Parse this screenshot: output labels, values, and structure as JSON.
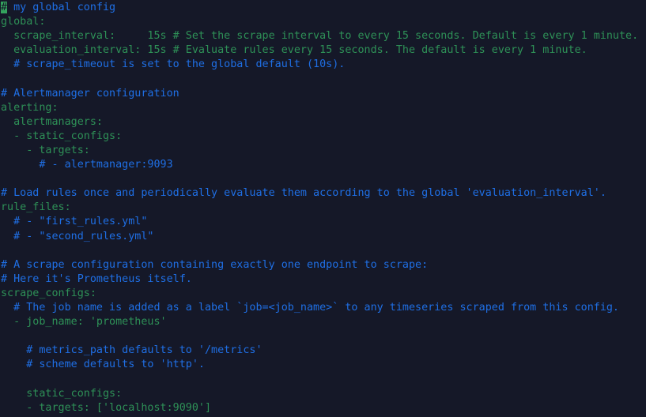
{
  "editor": {
    "background_color": "#151828",
    "comment_color": "#1f6fe5",
    "key_color": "#2e9157",
    "cursor_background_color": "#34a35e",
    "cursor_foreground_color": "#151828",
    "cursor_char": "#",
    "font_size_px": 13.4,
    "line_height_px": 18.1
  },
  "lines": [
    {
      "id": "line-1",
      "segments": [
        {
          "text": "#",
          "kind": "cursor"
        },
        {
          "text": " my global config",
          "kind": "comment"
        }
      ]
    },
    {
      "id": "line-2",
      "segments": [
        {
          "text": "global:",
          "kind": "key"
        }
      ]
    },
    {
      "id": "line-3",
      "segments": [
        {
          "text": "  scrape_interval:     15s # Set the scrape interval to every 15 seconds. Default is every 1 minute.",
          "kind": "key"
        }
      ]
    },
    {
      "id": "line-4",
      "segments": [
        {
          "text": "  evaluation_interval: 15s # Evaluate rules every 15 seconds. The default is every 1 minute.",
          "kind": "key"
        }
      ]
    },
    {
      "id": "line-5",
      "segments": [
        {
          "text": "  # scrape_timeout is set to the global default (10s).",
          "kind": "comment"
        }
      ]
    },
    {
      "id": "line-6",
      "segments": [
        {
          "text": "",
          "kind": "plain"
        }
      ]
    },
    {
      "id": "line-7",
      "segments": [
        {
          "text": "# Alertmanager configuration",
          "kind": "comment"
        }
      ]
    },
    {
      "id": "line-8",
      "segments": [
        {
          "text": "alerting:",
          "kind": "key"
        }
      ]
    },
    {
      "id": "line-9",
      "segments": [
        {
          "text": "  alertmanagers:",
          "kind": "key"
        }
      ]
    },
    {
      "id": "line-10",
      "segments": [
        {
          "text": "  - static_configs:",
          "kind": "key"
        }
      ]
    },
    {
      "id": "line-11",
      "segments": [
        {
          "text": "    - targets:",
          "kind": "key"
        }
      ]
    },
    {
      "id": "line-12",
      "segments": [
        {
          "text": "      # - alertmanager:9093",
          "kind": "comment"
        }
      ]
    },
    {
      "id": "line-13",
      "segments": [
        {
          "text": "",
          "kind": "plain"
        }
      ]
    },
    {
      "id": "line-14",
      "segments": [
        {
          "text": "# Load rules once and periodically evaluate them according to the global 'evaluation_interval'.",
          "kind": "comment"
        }
      ]
    },
    {
      "id": "line-15",
      "segments": [
        {
          "text": "rule_files:",
          "kind": "key"
        }
      ]
    },
    {
      "id": "line-16",
      "segments": [
        {
          "text": "  # - \"first_rules.yml\"",
          "kind": "comment"
        }
      ]
    },
    {
      "id": "line-17",
      "segments": [
        {
          "text": "  # - \"second_rules.yml\"",
          "kind": "comment"
        }
      ]
    },
    {
      "id": "line-18",
      "segments": [
        {
          "text": "",
          "kind": "plain"
        }
      ]
    },
    {
      "id": "line-19",
      "segments": [
        {
          "text": "# A scrape configuration containing exactly one endpoint to scrape:",
          "kind": "comment"
        }
      ]
    },
    {
      "id": "line-20",
      "segments": [
        {
          "text": "# Here it's Prometheus itself.",
          "kind": "comment"
        }
      ]
    },
    {
      "id": "line-21",
      "segments": [
        {
          "text": "scrape_configs:",
          "kind": "key"
        }
      ]
    },
    {
      "id": "line-22",
      "segments": [
        {
          "text": "  # The job name is added as a label `job=<job_name>` to any timeseries scraped from this config.",
          "kind": "comment"
        }
      ]
    },
    {
      "id": "line-23",
      "segments": [
        {
          "text": "  - job_name: 'prometheus'",
          "kind": "key"
        }
      ]
    },
    {
      "id": "line-24",
      "segments": [
        {
          "text": "",
          "kind": "plain"
        }
      ]
    },
    {
      "id": "line-25",
      "segments": [
        {
          "text": "    # metrics_path defaults to '/metrics'",
          "kind": "comment"
        }
      ]
    },
    {
      "id": "line-26",
      "segments": [
        {
          "text": "    # scheme defaults to 'http'.",
          "kind": "comment"
        }
      ]
    },
    {
      "id": "line-27",
      "segments": [
        {
          "text": "",
          "kind": "plain"
        }
      ]
    },
    {
      "id": "line-28",
      "segments": [
        {
          "text": "    static_configs:",
          "kind": "key"
        }
      ]
    },
    {
      "id": "line-29",
      "segments": [
        {
          "text": "    - targets: ['localhost:9090']",
          "kind": "key"
        }
      ]
    }
  ]
}
